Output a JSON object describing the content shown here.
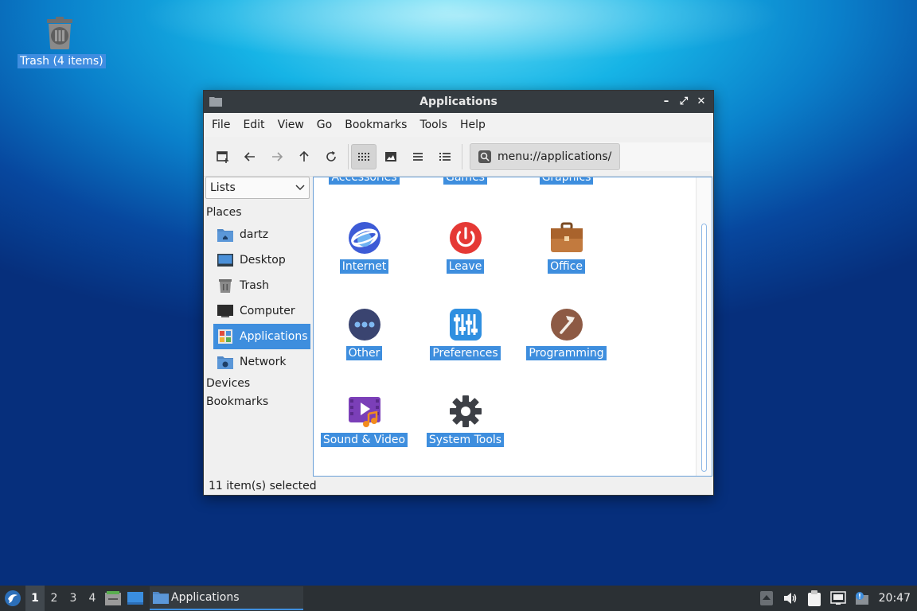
{
  "desktop": {
    "trash_label": "Trash (4 items)"
  },
  "window": {
    "title": "Applications",
    "controls": {
      "minimize": "–",
      "maximize": "⤢",
      "close": "✕"
    }
  },
  "menubar": {
    "items": [
      "File",
      "Edit",
      "View",
      "Go",
      "Bookmarks",
      "Tools",
      "Help"
    ]
  },
  "toolbar": {
    "location": "menu://applications/"
  },
  "sidebar": {
    "mode": "Lists",
    "places_heading": "Places",
    "items": [
      {
        "label": "dartz",
        "icon": "home-folder-icon"
      },
      {
        "label": "Desktop",
        "icon": "desktop-icon"
      },
      {
        "label": "Trash",
        "icon": "trash-icon"
      },
      {
        "label": "Computer",
        "icon": "computer-icon"
      },
      {
        "label": "Applications",
        "icon": "applications-icon",
        "selected": true
      },
      {
        "label": "Network",
        "icon": "network-folder-icon"
      }
    ],
    "devices_heading": "Devices",
    "bookmarks_heading": "Bookmarks"
  },
  "content": {
    "partial_items": [
      "Accessories",
      "Games",
      "Graphics"
    ],
    "apps": [
      {
        "label": "Internet",
        "icon": "internet-icon"
      },
      {
        "label": "Leave",
        "icon": "power-icon"
      },
      {
        "label": "Office",
        "icon": "briefcase-icon"
      },
      {
        "label": "Other",
        "icon": "other-dots-icon"
      },
      {
        "label": "Preferences",
        "icon": "preferences-sliders-icon"
      },
      {
        "label": "Programming",
        "icon": "hammer-icon"
      },
      {
        "label": "Sound & Video",
        "icon": "sound-video-icon"
      },
      {
        "label": "System Tools",
        "icon": "gear-icon"
      }
    ]
  },
  "statusbar": {
    "text": "11 item(s) selected"
  },
  "taskbar": {
    "workspaces": [
      "1",
      "2",
      "3",
      "4"
    ],
    "active_workspace": "1",
    "task_label": "Applications",
    "clock": "20:47"
  },
  "colors": {
    "selection": "#3e8ede",
    "titlebar": "#353b40",
    "taskbar": "#2b3034"
  }
}
